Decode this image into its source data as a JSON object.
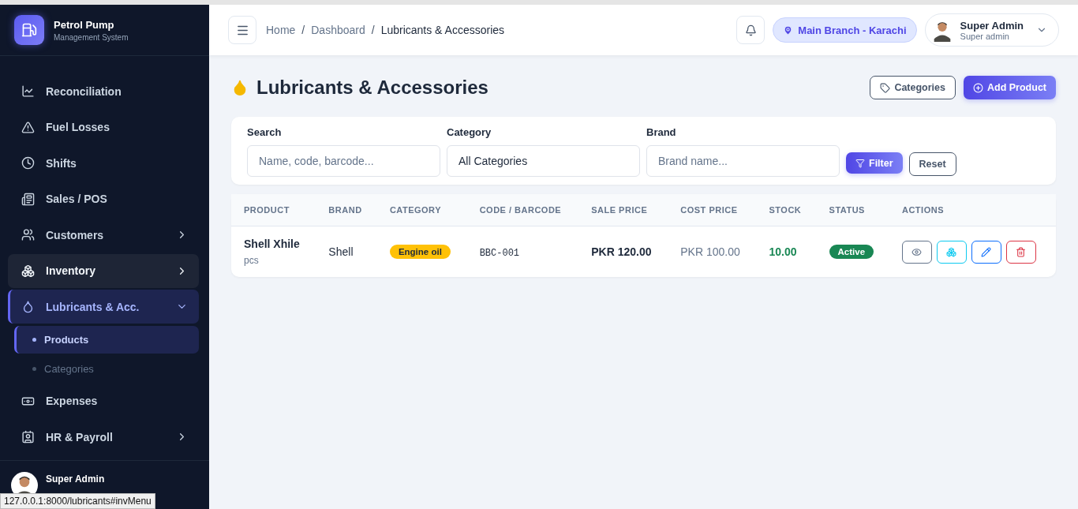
{
  "brand": {
    "title": "Petrol Pump",
    "subtitle": "Management System"
  },
  "sidebar": {
    "items": [
      {
        "label": "Reconciliation",
        "has_arrow": false,
        "highlighted": false,
        "selected": false
      },
      {
        "label": "Fuel Losses",
        "has_arrow": false,
        "highlighted": false,
        "selected": false
      },
      {
        "label": "Shifts",
        "has_arrow": false,
        "highlighted": false,
        "selected": false
      },
      {
        "label": "Sales / POS",
        "has_arrow": false,
        "highlighted": false,
        "selected": false
      },
      {
        "label": "Customers",
        "has_arrow": true,
        "highlighted": false,
        "selected": false
      },
      {
        "label": "Inventory",
        "has_arrow": true,
        "highlighted": true,
        "selected": false
      },
      {
        "label": "Lubricants & Acc.",
        "has_arrow": true,
        "highlighted": false,
        "selected": true,
        "expanded": true,
        "children": [
          {
            "label": "Products",
            "selected": true
          },
          {
            "label": "Categories",
            "selected": false
          }
        ]
      },
      {
        "label": "Expenses",
        "has_arrow": false,
        "highlighted": false,
        "selected": false
      },
      {
        "label": "HR & Payroll",
        "has_arrow": true,
        "highlighted": false,
        "selected": false
      }
    ],
    "user": {
      "name": "Super Admin"
    }
  },
  "status_url": "127.0.0.1:8000/lubricants#invMenu",
  "breadcrumb": [
    {
      "label": "Home",
      "current": false
    },
    {
      "separator": "/",
      "label": "Dashboard",
      "current": false
    },
    {
      "separator": "/",
      "label": "Lubricants & Accessories",
      "current": true
    }
  ],
  "branch": "Main Branch - Karachi",
  "user": {
    "name": "Super Admin",
    "role": "Super admin"
  },
  "page_title": "Lubricants & Accessories",
  "header_buttons": [
    {
      "label": "Categories",
      "kind": "outline"
    },
    {
      "label": "Add Product",
      "kind": "primary"
    }
  ],
  "filters": [
    {
      "label": "Search",
      "placeholder": "Name, code, barcode..."
    },
    {
      "label": "Category",
      "value": "All Categories"
    },
    {
      "label": "Brand",
      "placeholder": "Brand name..."
    }
  ],
  "filter_buttons": [
    {
      "label": "Filter",
      "kind": "primary"
    },
    {
      "label": "Reset",
      "kind": "outline"
    }
  ],
  "table": {
    "columns": [
      "PRODUCT",
      "BRAND",
      "CATEGORY",
      "CODE / BARCODE",
      "SALE PRICE",
      "COST PRICE",
      "STOCK",
      "STATUS",
      "ACTIONS"
    ],
    "rows": [
      {
        "product": "Shell Xhile",
        "unit": "pcs",
        "brand": "Shell",
        "category": "Engine oil",
        "code": "BBC-001",
        "sale_price": "PKR 120.00",
        "cost_price": "PKR 100.00",
        "stock": "10.00",
        "status": {
          "label": "Active",
          "kind": "success"
        },
        "actions": [
          {
            "kind": "view"
          },
          {
            "kind": "stock"
          },
          {
            "kind": "edit"
          },
          {
            "kind": "delete"
          }
        ]
      }
    ]
  }
}
